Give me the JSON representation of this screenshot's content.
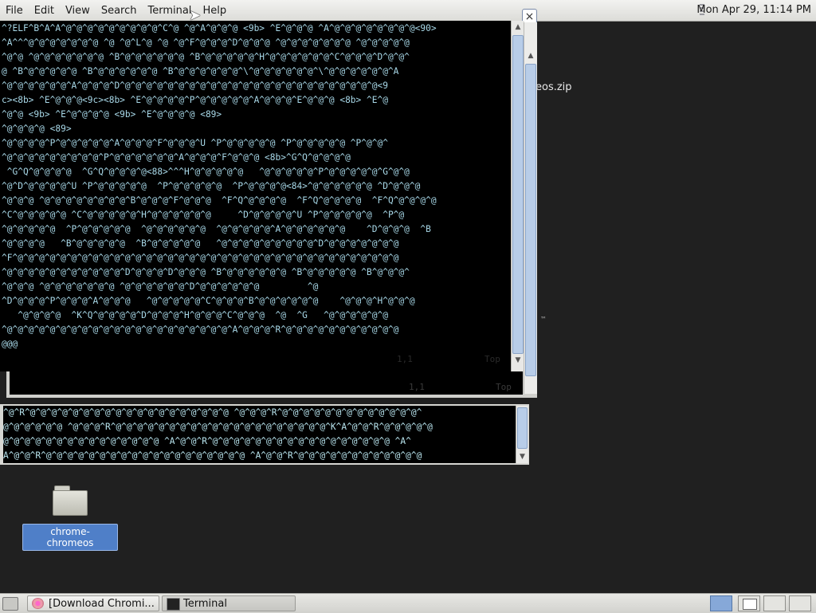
{
  "menubar": {
    "items": [
      {
        "label": "File"
      },
      {
        "label": "Edit"
      },
      {
        "label": "View"
      },
      {
        "label": "Search"
      },
      {
        "label": "Terminal"
      },
      {
        "label": "Help"
      }
    ]
  },
  "clock": "Mon Apr 29, 11:14 PM",
  "window_close_glyph": "×",
  "desktop": {
    "partial_label": "eos.zip",
    "tm_mark": "™",
    "folder_label": "chrome-chromeos"
  },
  "terminal_main": {
    "lines": [
      "^?ELF^B^A^A^@^@^@^@^@^@^@^@^@^C^@ ^@^A^@^@^@ <9b> ^E^@^@^@ ^A^@^@^@^@^@^@^@^@<90> ",
      "^A^^^@^@^@^@^@^@^@ ^@ ^@^L^@ ^@ ^@^F^@^@^@^D^@^@^@ ^@^@^@^@^@^@^@ ^@^@^@^@^@",
      "^@^@ ^@^@^@^@^@^@^@ ^B^@^@^@^@^@^@ ^B^@^@^@^@^@^H^@^@^@^@^@^@^C^@^@^@^D^@^@^",
      "@ ^B^@^@^@^@^@ ^B^@^@^@^@^@^@ ^B^@^@^@^@^@^@^\\^@^@^@^@^@^@^\\^@^@^@^@^@^@^A",
      "^@^@^@^@^@^@^A^@^@^@^D^@^@^@^@^@^@^@^@^@^@^@^@^@^@^@^@^@^@^@^@^@^@^@^@<9",
      "c><8b> ^E^@^@^@<9c><8b> ^E^@^@^@^@^P^@^@^@^@^@^A^@^@^@^E^@^@^@ <8b> ^E^@",
      "^@^@ <9b> ^E^@^@^@^@ <9b> ^E^@^@^@^@ <89>",
      "^@^@^@^@ <89>",
      "^@^@^@^@^P^@^@^@^@^@^A^@^@^@^F^@^@^@^U ^P^@^@^@^@^@ ^P^@^@^@^@^@ ^P^@^@^",
      "^@^@^@^@^@^@^@^@^@^P^@^@^@^@^@^@^A^@^@^@^F^@^@^@ <8b>^G^Q^@^@^@^@",
      " ^G^Q^@^@^@^@  ^G^Q^@^@^@^@<88>^^^H^@^@^@^@^@   ^@^@^@^@^@^P^@^@^@^@^@^G^@^@",
      "^@^D^@^@^@^@^U ^P^@^@^@^@^@  ^P^@^@^@^@^@  ^P^@^@^@^@<84>^@^@^@^@^@^@ ^D^@^@^@",
      "^@^@^@ ^@^@^@^@^@^@^@^@^B^@^@^@^F^@^@^@  ^F^Q^@^@^@^@  ^F^Q^@^@^@^@  ^F^Q^@^@^@^@",
      "^C^@^@^@^@^@ ^C^@^@^@^@^@^H^@^@^@^@^@^@     ^D^@^@^@^@^U ^P^@^@^@^@^@  ^P^@",
      "^@^@^@^@^@  ^P^@^@^@^@^@  ^@^@^@^@^@^@  ^@^@^@^@^@^A^@^@^@^@^@^@    ^D^@^@^@  ^B",
      "^@^@^@^@   ^B^@^@^@^@^@  ^B^@^@^@^@^@   ^@^@^@^@^@^@^@^@^@^D^@^@^@^@^@^@^@",
      "^F^@^@^@^@^@^@^@^@^@^@^@^@^@^@^@^@^@^@^@^@^@^@^@^@^@^@^@^@^@^@^@^@^@^@^@^@",
      "^@^@^@^@^@^@^@^@^@^@^@^D^@^@^@^D^@^@^@ ^B^@^@^@^@^@^@ ^B^@^@^@^@^@ ^B^@^@^@^",
      "^@^@^@ ^@^@^@^@^@^@^@ ^@^@^@^@^@^@^D^@^@^@^@^@^@         ^@",
      "^D^@^@^@^P^@^@^@^A^@^@^@   ^@^@^@^@^@^C^@^@^@^B^@^@^@^@^@^@    ^@^@^@^H^@^@^@",
      "   ^@^@^@^@  ^K^Q^@^@^@^@^D^@^@^@^H^@^@^@^C^@^@^@  ^@  ^G   ^@^@^@^@^@^@",
      "^@^@^@^@^@^@^@^@^@^@^@^@^@^@^@^@^@^@^@^@^@^A^@^@^@^R^@^@^@^@^@^@^@^@^@^@^@",
      "@@@"
    ],
    "status_pos": "1,1",
    "status_top": "Top"
  },
  "terminal_behind": {
    "prompt": "@@@",
    "status_pos": "1,1",
    "status_top": "Top"
  },
  "terminal_small": {
    "lines": [
      "^@^R^@^@^@^@^@^@^@^@^@^@^@^@^@^@^@^@^@^@^@ ^@^@^@^R^@^@^@^@^@^@^@^@^@^@^@^@^@^",
      "@^@^@^@^@^@ ^@^@^@^R^@^@^@^@^@^@^@^@^@^@^@^@^@^@^@^@^@^@^@^@^K^A^@^@^R^@^@^@^@^@",
      "@^@^@^@^@^@^@^@^@^@^@^@^@^@^@ ^A^@^@^R^@^@^@^@^@^@^@^@^@^@^@^@^@^@^@^@^@ ^A^",
      "A^@^@^R^@^@^@^@^@^@^@^@^@^@^@^@^@^@^@^@^@^@^@ ^A^@^@^R^@^@^@^@^@^@^@^@^@^@^@^@"
    ]
  },
  "taskbar": {
    "items": [
      {
        "label": "[Download Chromi..."
      },
      {
        "label": "Terminal"
      }
    ]
  }
}
